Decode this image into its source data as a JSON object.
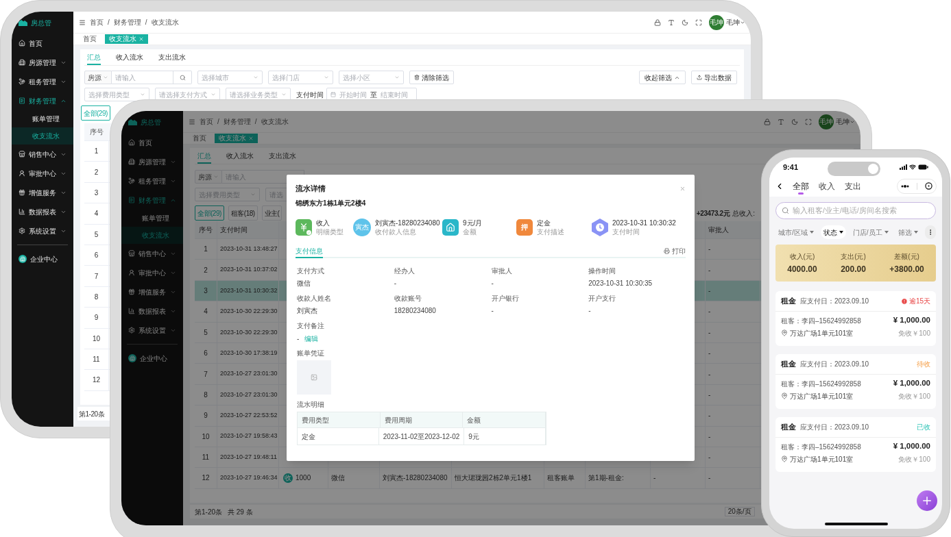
{
  "back_screen": {
    "sidebar": {
      "logo": "房总管",
      "items": [
        {
          "kind": "link",
          "label": "首页",
          "selected": false
        },
        {
          "kind": "group",
          "label": "房源管理",
          "expanded": false,
          "selected": false
        },
        {
          "kind": "group",
          "label": "租务管理",
          "expanded": false,
          "selected": false
        },
        {
          "kind": "group",
          "label": "财务管理",
          "expanded": true,
          "selected": true,
          "children": [
            {
              "label": "账单管理",
              "selected": false
            },
            {
              "label": "收支流水",
              "selected": true
            }
          ]
        },
        {
          "kind": "group",
          "label": "销售中心",
          "expanded": false,
          "selected": false
        },
        {
          "kind": "group",
          "label": "审批中心",
          "expanded": false,
          "selected": false
        },
        {
          "kind": "group",
          "label": "增值服务",
          "expanded": false,
          "selected": false
        },
        {
          "kind": "group",
          "label": "数据报表",
          "expanded": false,
          "selected": false
        },
        {
          "kind": "group",
          "label": "系统设置",
          "expanded": false,
          "selected": false
        },
        {
          "kind": "company",
          "label": "企业中心",
          "selected": false
        }
      ]
    },
    "breadcrumb": {
      "items": [
        "首页",
        "财务管理",
        "收支流水"
      ],
      "separator": "/"
    },
    "user": {
      "avatar": "毛坤",
      "name": "毛坤"
    },
    "open_tabs": [
      {
        "label": "首页",
        "selected": false,
        "closable": false
      },
      {
        "label": "收支流水",
        "selected": true,
        "closable": true
      }
    ],
    "tabs": [
      {
        "label": "汇总",
        "selected": true
      },
      {
        "label": "收入流水",
        "selected": false
      },
      {
        "label": "支出流水",
        "selected": false
      }
    ],
    "filters": [
      {
        "kind": "search",
        "select": "房源",
        "placeholder": "请输入"
      },
      {
        "kind": "select",
        "placeholder": "选择城市"
      },
      {
        "kind": "select",
        "placeholder": "选择门店"
      },
      {
        "kind": "select",
        "placeholder": "选择小区"
      },
      {
        "kind": "clear",
        "label": "清除筛选"
      }
    ],
    "filter_actions": [
      {
        "kind": "collapse",
        "label": "收起筛选"
      },
      {
        "kind": "export",
        "label": "导出数据"
      }
    ],
    "filters_row_2": [
      {
        "kind": "select",
        "placeholder": "选择费用类型"
      },
      {
        "kind": "select",
        "placeholder": "请选择支付方式"
      },
      {
        "kind": "select",
        "placeholder": "请选择业务类型"
      },
      {
        "kind": "date_range",
        "label": "支付时间",
        "start_placeholder": "开始时间",
        "separator": "至",
        "end_placeholder": "结束时间"
      }
    ],
    "type_pills": [
      {
        "label": "全部(29)",
        "selected": true
      }
    ],
    "table": {
      "columns": [
        "序号"
      ],
      "rows": [
        "1",
        "2",
        "3",
        "4",
        "5",
        "6",
        "7",
        "8",
        "9",
        "10",
        "11",
        "12"
      ]
    },
    "pagination": {
      "range": "第1-20条"
    }
  },
  "front_screen": {
    "sidebar": {
      "logo": "房总管",
      "items": [
        {
          "kind": "link",
          "label": "首页",
          "selected": false
        },
        {
          "kind": "group",
          "label": "房源管理",
          "expanded": false,
          "selected": false
        },
        {
          "kind": "group",
          "label": "租务管理",
          "expanded": false,
          "selected": false
        },
        {
          "kind": "group",
          "label": "财务管理",
          "expanded": true,
          "selected": true,
          "children": [
            {
              "label": "账单管理",
              "selected": false
            },
            {
              "label": "收支流水",
              "selected": true
            }
          ]
        },
        {
          "kind": "group",
          "label": "销售中心",
          "expanded": false,
          "selected": false
        },
        {
          "kind": "group",
          "label": "审批中心",
          "expanded": false,
          "selected": false
        },
        {
          "kind": "group",
          "label": "增值服务",
          "expanded": false,
          "selected": false
        },
        {
          "kind": "group",
          "label": "数据报表",
          "expanded": false,
          "selected": false
        },
        {
          "kind": "group",
          "label": "系统设置",
          "expanded": false,
          "selected": false
        },
        {
          "kind": "company",
          "label": "企业中心",
          "selected": false
        }
      ]
    },
    "breadcrumb": {
      "items": [
        "首页",
        "财务管理",
        "收支流水"
      ],
      "separator": "/"
    },
    "user": {
      "avatar": "毛坤",
      "name": "毛坤"
    },
    "open_tabs": [
      {
        "label": "首页",
        "selected": false,
        "closable": false
      },
      {
        "label": "收支流水",
        "selected": true,
        "closable": true
      }
    ],
    "tabs": [
      {
        "label": "汇总",
        "selected": true
      },
      {
        "label": "收入流水",
        "selected": false
      },
      {
        "label": "支出流水",
        "selected": false
      }
    ],
    "filters": [
      {
        "kind": "keyword",
        "select": "房源",
        "placeholder": "请输入"
      }
    ],
    "filters_row_2": [
      {
        "kind": "select",
        "placeholder": "选择费用类型"
      },
      {
        "kind": "cut_select",
        "placeholder": "请选"
      }
    ],
    "type_pills": [
      {
        "label": "全部(29)",
        "selected": true
      },
      {
        "label": "租客(18)",
        "selected": false
      },
      {
        "label": "业主(",
        "selected": false
      }
    ],
    "totals": [
      "+23473.2元",
      "总收入:"
    ],
    "table": {
      "columns": {
        "index": "序号",
        "time": "支付时间",
        "approver": "审批人"
      },
      "rows": [
        {
          "index": "1",
          "time": "2023-10-31 13:48:27",
          "approver": "-",
          "selected": false
        },
        {
          "index": "2",
          "time": "2023-10-31 10:37:02",
          "approver": "-",
          "selected": false
        },
        {
          "index": "3",
          "time": "2023-10-31 10:30:32",
          "approver": "-",
          "selected": true
        },
        {
          "index": "4",
          "time": "2023-10-30 22:29:30",
          "approver": "-",
          "selected": false
        },
        {
          "index": "5",
          "time": "2023-10-30 22:29:30",
          "approver": "-",
          "selected": false
        },
        {
          "index": "6",
          "time": "2023-10-30 17:38:19",
          "approver": "-",
          "selected": false
        },
        {
          "index": "7",
          "time": "2023-10-27 23:01:30",
          "approver": "-",
          "selected": false
        },
        {
          "index": "8",
          "time": "2023-10-27 23:01:30",
          "approver": "-",
          "selected": false
        },
        {
          "index": "9",
          "time": "2023-10-27 22:53:52",
          "approver": "-",
          "selected": false
        },
        {
          "index": "10",
          "time": "2023-10-27 19:58:43",
          "approver": "-",
          "selected": false
        },
        {
          "index": "11",
          "time": "2023-10-27 19:48:11",
          "approver": "-",
          "selected": false
        },
        {
          "index": "12",
          "time": "2023-10-27 19:46:34",
          "type_badge": "收",
          "amount": "1000",
          "method": "微信",
          "payer": "刘寅杰-18280234080",
          "property": "恒大珺珑园2栋2单元1楼1",
          "bill_type": "租客账单",
          "description": "第1期-租金:",
          "column_9": "-",
          "approver": "-",
          "selected": false
        }
      ]
    },
    "pagination": {
      "range": "第1-20条",
      "total": "共 29 条",
      "page_size": "20条/页"
    },
    "detail_dialog": {
      "title": "流水详情",
      "subtitle": "锦绣东方1栋1单元2楼4",
      "highlights": [
        {
          "kind": "income",
          "value": "收入",
          "label": "明细类型"
        },
        {
          "kind": "person",
          "avatar": "寅杰",
          "value": "刘寅杰-18280234080",
          "label": "收付款人信息"
        },
        {
          "kind": "amount",
          "value": "9元/月",
          "label": "金额"
        },
        {
          "kind": "deposit",
          "badge": "押",
          "value": "定金",
          "label": "支付描述"
        },
        {
          "kind": "time",
          "value": "2023-10-31 10:30:32",
          "label": "支付时间"
        }
      ],
      "tabs": [
        {
          "label": "支付信息",
          "selected": true
        }
      ],
      "print": "打印",
      "fields": [
        {
          "label": "支付方式",
          "value": "微信"
        },
        {
          "label": "经办人",
          "value": "-"
        },
        {
          "label": "审批人",
          "value": "-"
        },
        {
          "label": "操作时间",
          "value": "2023-10-31 10:30:35"
        },
        {
          "label": "收款人姓名",
          "value": "刘寅杰"
        },
        {
          "label": "收款账号",
          "value": "18280234080"
        },
        {
          "label": "开户银行",
          "value": "-"
        },
        {
          "label": "开户支行",
          "value": "-"
        }
      ],
      "remark": {
        "label": "支付备注",
        "value": "-",
        "link": "编辑"
      },
      "voucher": {
        "label": "账单凭证"
      },
      "items_title": "流水明细",
      "items_table": {
        "columns": [
          "费用类型",
          "费用周期",
          "金额"
        ],
        "rows": [
          [
            "定金",
            "2023-11-02至2023-12-02",
            "9元"
          ]
        ]
      }
    }
  },
  "phone": {
    "time": "9:41",
    "tabs": [
      {
        "label": "全部",
        "selected": true
      },
      {
        "label": "收入",
        "selected": false
      },
      {
        "label": "支出",
        "selected": false
      }
    ],
    "search": {
      "placeholder": "输入租客/业主/电话/房间名搜索"
    },
    "filters": [
      {
        "label": "城市/区域",
        "selected": false
      },
      {
        "label": "状态",
        "selected": true
      },
      {
        "label": "门店/员工",
        "selected": false
      },
      {
        "label": "筛选",
        "selected": false
      }
    ],
    "summary": [
      {
        "label": "收入(元)",
        "value": "4000.00"
      },
      {
        "label": "支出(元)",
        "value": "200.00"
      },
      {
        "label": "差额(元)",
        "value": "+3800.00"
      }
    ],
    "records": [
      {
        "category": "租金",
        "due": "应支付日：2023.09.10",
        "status": {
          "kind": "overdue",
          "label": "逾15天"
        },
        "tenant": "租客：李四–15624992858",
        "amount": "¥ 1,000.00",
        "address": "万达广场1单元101室",
        "waiver": "免收￥100"
      },
      {
        "category": "租金",
        "due": "应支付日：2023.09.10",
        "status": {
          "kind": "pending",
          "label": "待收"
        },
        "tenant": "租客：李四–15624992858",
        "amount": "¥ 1,000.00",
        "address": "万达广场1单元101室",
        "waiver": "免收￥100"
      },
      {
        "category": "租金",
        "due": "应支付日：2023.09.10",
        "status": {
          "kind": "done",
          "label": "已收"
        },
        "tenant": "租客：李四–15624992858",
        "amount": "¥ 1,000.00",
        "address": "万达广场1单元101室",
        "waiver": "免收￥100"
      }
    ]
  }
}
